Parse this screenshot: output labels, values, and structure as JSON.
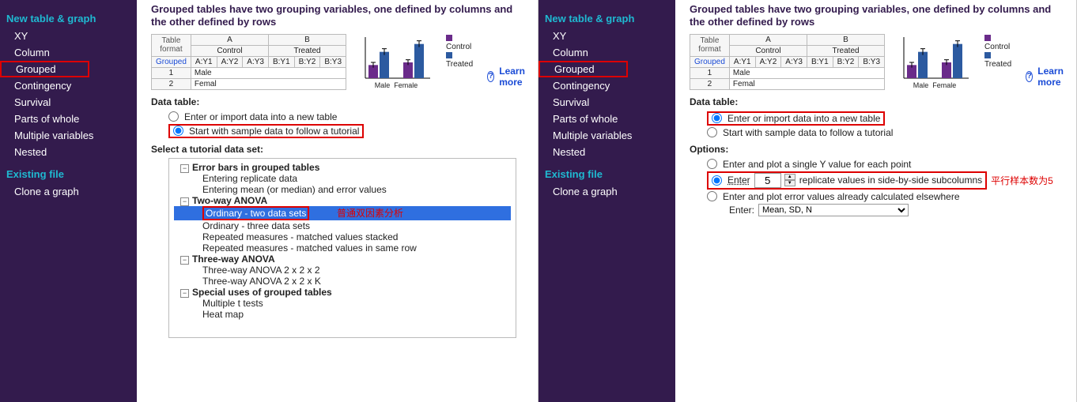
{
  "sidebar": {
    "heading1": "New table & graph",
    "items": [
      "XY",
      "Column",
      "Grouped",
      "Contingency",
      "Survival",
      "Parts of whole",
      "Multiple variables",
      "Nested"
    ],
    "heading2": "Existing file",
    "items2": [
      "Clone a graph"
    ]
  },
  "title": "Grouped tables have two grouping variables, one defined by columns and the other defined by rows",
  "learn_more": "Learn more",
  "preview": {
    "tf_label": "Table format",
    "tf_value": "Grouped",
    "colgroups": [
      "A",
      "B"
    ],
    "subheads": [
      "Control",
      "Treated"
    ],
    "cols": [
      "A:Y1",
      "A:Y2",
      "A:Y3",
      "B:Y1",
      "B:Y2",
      "B:Y3"
    ],
    "row1": "Male",
    "row2": "Femal",
    "legend": [
      "Control",
      "Treated"
    ],
    "xcats": [
      "Male",
      "Female"
    ]
  },
  "chart_data": {
    "type": "bar",
    "categories": [
      "Male",
      "Female"
    ],
    "series": [
      {
        "name": "Control",
        "values": [
          5,
          6
        ],
        "err": [
          1,
          1
        ],
        "color": "#6a2b8a"
      },
      {
        "name": "Treated",
        "values": [
          10,
          13
        ],
        "err": [
          1.2,
          1.2
        ],
        "color": "#2c5aa0"
      }
    ],
    "ylim": [
      0,
      15
    ]
  },
  "left": {
    "data_table": "Data table:",
    "opt1": "Enter or import data into a new table",
    "opt2": "Start with sample data to follow a tutorial",
    "select_label": "Select a tutorial data set:",
    "tree": {
      "g1": "Error bars in grouped tables",
      "g1a": "Entering replicate data",
      "g1b": "Entering mean (or median) and error values",
      "g2": "Two-way ANOVA",
      "g2a": "Ordinary - two data sets",
      "g2a_ann": "普通双因素分析",
      "g2b": "Ordinary - three data sets",
      "g2c": "Repeated measures - matched values stacked",
      "g2d": "Repeated measures - matched values in same row",
      "g3": "Three-way ANOVA",
      "g3a": "Three-way ANOVA 2 x 2 x 2",
      "g3b": "Three-way ANOVA 2 x 2 x K",
      "g4": "Special uses of grouped tables",
      "g4a": "Multiple t tests",
      "g4b": "Heat map"
    }
  },
  "right": {
    "data_table": "Data table:",
    "opt1": "Enter or import data into a new table",
    "opt2": "Start with sample data to follow a tutorial",
    "options_label": "Options:",
    "o1": "Enter and plot a single Y value for each point",
    "o2_a": "Enter",
    "o2_val": "5",
    "o2_b": "replicate values in side-by-side subcolumns",
    "o2_ann": "平行样本数为5",
    "o3": "Enter and plot error values already calculated elsewhere",
    "enter_label": "Enter:",
    "select_value": "Mean, SD, N"
  }
}
